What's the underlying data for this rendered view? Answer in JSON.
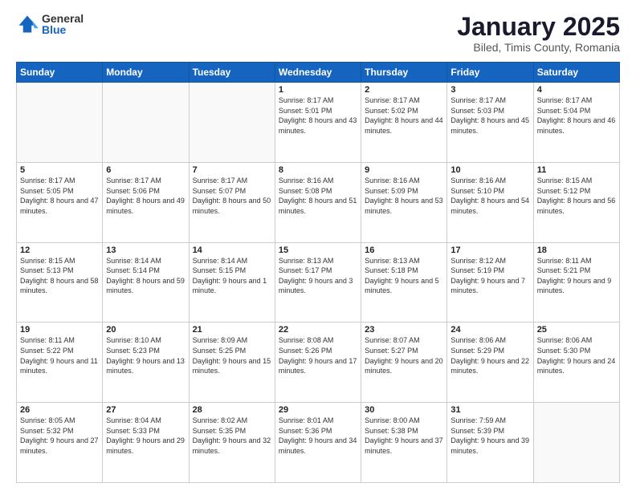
{
  "logo": {
    "general": "General",
    "blue": "Blue"
  },
  "header": {
    "title": "January 2025",
    "subtitle": "Biled, Timis County, Romania"
  },
  "weekdays": [
    "Sunday",
    "Monday",
    "Tuesday",
    "Wednesday",
    "Thursday",
    "Friday",
    "Saturday"
  ],
  "weeks": [
    [
      {
        "day": "",
        "sunrise": "",
        "sunset": "",
        "daylight": ""
      },
      {
        "day": "",
        "sunrise": "",
        "sunset": "",
        "daylight": ""
      },
      {
        "day": "",
        "sunrise": "",
        "sunset": "",
        "daylight": ""
      },
      {
        "day": "1",
        "sunrise": "Sunrise: 8:17 AM",
        "sunset": "Sunset: 5:01 PM",
        "daylight": "Daylight: 8 hours and 43 minutes."
      },
      {
        "day": "2",
        "sunrise": "Sunrise: 8:17 AM",
        "sunset": "Sunset: 5:02 PM",
        "daylight": "Daylight: 8 hours and 44 minutes."
      },
      {
        "day": "3",
        "sunrise": "Sunrise: 8:17 AM",
        "sunset": "Sunset: 5:03 PM",
        "daylight": "Daylight: 8 hours and 45 minutes."
      },
      {
        "day": "4",
        "sunrise": "Sunrise: 8:17 AM",
        "sunset": "Sunset: 5:04 PM",
        "daylight": "Daylight: 8 hours and 46 minutes."
      }
    ],
    [
      {
        "day": "5",
        "sunrise": "Sunrise: 8:17 AM",
        "sunset": "Sunset: 5:05 PM",
        "daylight": "Daylight: 8 hours and 47 minutes."
      },
      {
        "day": "6",
        "sunrise": "Sunrise: 8:17 AM",
        "sunset": "Sunset: 5:06 PM",
        "daylight": "Daylight: 8 hours and 49 minutes."
      },
      {
        "day": "7",
        "sunrise": "Sunrise: 8:17 AM",
        "sunset": "Sunset: 5:07 PM",
        "daylight": "Daylight: 8 hours and 50 minutes."
      },
      {
        "day": "8",
        "sunrise": "Sunrise: 8:16 AM",
        "sunset": "Sunset: 5:08 PM",
        "daylight": "Daylight: 8 hours and 51 minutes."
      },
      {
        "day": "9",
        "sunrise": "Sunrise: 8:16 AM",
        "sunset": "Sunset: 5:09 PM",
        "daylight": "Daylight: 8 hours and 53 minutes."
      },
      {
        "day": "10",
        "sunrise": "Sunrise: 8:16 AM",
        "sunset": "Sunset: 5:10 PM",
        "daylight": "Daylight: 8 hours and 54 minutes."
      },
      {
        "day": "11",
        "sunrise": "Sunrise: 8:15 AM",
        "sunset": "Sunset: 5:12 PM",
        "daylight": "Daylight: 8 hours and 56 minutes."
      }
    ],
    [
      {
        "day": "12",
        "sunrise": "Sunrise: 8:15 AM",
        "sunset": "Sunset: 5:13 PM",
        "daylight": "Daylight: 8 hours and 58 minutes."
      },
      {
        "day": "13",
        "sunrise": "Sunrise: 8:14 AM",
        "sunset": "Sunset: 5:14 PM",
        "daylight": "Daylight: 8 hours and 59 minutes."
      },
      {
        "day": "14",
        "sunrise": "Sunrise: 8:14 AM",
        "sunset": "Sunset: 5:15 PM",
        "daylight": "Daylight: 9 hours and 1 minute."
      },
      {
        "day": "15",
        "sunrise": "Sunrise: 8:13 AM",
        "sunset": "Sunset: 5:17 PM",
        "daylight": "Daylight: 9 hours and 3 minutes."
      },
      {
        "day": "16",
        "sunrise": "Sunrise: 8:13 AM",
        "sunset": "Sunset: 5:18 PM",
        "daylight": "Daylight: 9 hours and 5 minutes."
      },
      {
        "day": "17",
        "sunrise": "Sunrise: 8:12 AM",
        "sunset": "Sunset: 5:19 PM",
        "daylight": "Daylight: 9 hours and 7 minutes."
      },
      {
        "day": "18",
        "sunrise": "Sunrise: 8:11 AM",
        "sunset": "Sunset: 5:21 PM",
        "daylight": "Daylight: 9 hours and 9 minutes."
      }
    ],
    [
      {
        "day": "19",
        "sunrise": "Sunrise: 8:11 AM",
        "sunset": "Sunset: 5:22 PM",
        "daylight": "Daylight: 9 hours and 11 minutes."
      },
      {
        "day": "20",
        "sunrise": "Sunrise: 8:10 AM",
        "sunset": "Sunset: 5:23 PM",
        "daylight": "Daylight: 9 hours and 13 minutes."
      },
      {
        "day": "21",
        "sunrise": "Sunrise: 8:09 AM",
        "sunset": "Sunset: 5:25 PM",
        "daylight": "Daylight: 9 hours and 15 minutes."
      },
      {
        "day": "22",
        "sunrise": "Sunrise: 8:08 AM",
        "sunset": "Sunset: 5:26 PM",
        "daylight": "Daylight: 9 hours and 17 minutes."
      },
      {
        "day": "23",
        "sunrise": "Sunrise: 8:07 AM",
        "sunset": "Sunset: 5:27 PM",
        "daylight": "Daylight: 9 hours and 20 minutes."
      },
      {
        "day": "24",
        "sunrise": "Sunrise: 8:06 AM",
        "sunset": "Sunset: 5:29 PM",
        "daylight": "Daylight: 9 hours and 22 minutes."
      },
      {
        "day": "25",
        "sunrise": "Sunrise: 8:06 AM",
        "sunset": "Sunset: 5:30 PM",
        "daylight": "Daylight: 9 hours and 24 minutes."
      }
    ],
    [
      {
        "day": "26",
        "sunrise": "Sunrise: 8:05 AM",
        "sunset": "Sunset: 5:32 PM",
        "daylight": "Daylight: 9 hours and 27 minutes."
      },
      {
        "day": "27",
        "sunrise": "Sunrise: 8:04 AM",
        "sunset": "Sunset: 5:33 PM",
        "daylight": "Daylight: 9 hours and 29 minutes."
      },
      {
        "day": "28",
        "sunrise": "Sunrise: 8:02 AM",
        "sunset": "Sunset: 5:35 PM",
        "daylight": "Daylight: 9 hours and 32 minutes."
      },
      {
        "day": "29",
        "sunrise": "Sunrise: 8:01 AM",
        "sunset": "Sunset: 5:36 PM",
        "daylight": "Daylight: 9 hours and 34 minutes."
      },
      {
        "day": "30",
        "sunrise": "Sunrise: 8:00 AM",
        "sunset": "Sunset: 5:38 PM",
        "daylight": "Daylight: 9 hours and 37 minutes."
      },
      {
        "day": "31",
        "sunrise": "Sunrise: 7:59 AM",
        "sunset": "Sunset: 5:39 PM",
        "daylight": "Daylight: 9 hours and 39 minutes."
      },
      {
        "day": "",
        "sunrise": "",
        "sunset": "",
        "daylight": ""
      }
    ]
  ]
}
